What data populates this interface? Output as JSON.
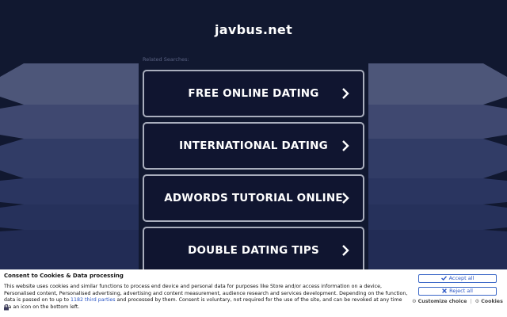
{
  "header": {
    "site_title": "javbus.net"
  },
  "related": {
    "label": "Related Searches:",
    "items": [
      {
        "label": "FREE ONLINE DATING"
      },
      {
        "label": "INTERNATIONAL DATING"
      },
      {
        "label": "ADWORDS TUTORIAL ONLINE"
      },
      {
        "label": "DOUBLE DATING TIPS"
      }
    ]
  },
  "consent": {
    "title": "Consent to Cookies & Data processing",
    "text_before_link": "This website uses cookies and similar functions to process end device and personal data for purposes like Store and/or access information on a device, Personalised content, Personalised advertising, advertising and content measurement, audience research and services development. Depending on the function, data is passed on to up to ",
    "link_text": "1182 third parties",
    "text_after_link": " and processed by them. Consent is voluntary, not required for the use of the site, and can be revoked at any time via an icon on the bottom left.",
    "accept_label": "Accept all",
    "reject_label": "Reject all",
    "customize_label": "Customize choice",
    "separator": "|",
    "cookies_label": "Cookies"
  },
  "colors": {
    "background": "#111830",
    "button_background": "#101530",
    "button_border": "#a9aebd",
    "link": "#2a55c4"
  }
}
